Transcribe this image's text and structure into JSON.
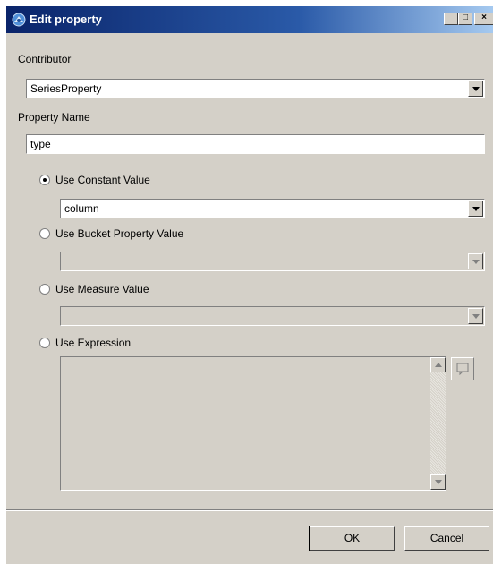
{
  "window": {
    "title": "Edit property",
    "icon": "app-icon",
    "controls": {
      "minimize": "_",
      "maximize": "□",
      "close": "×"
    }
  },
  "contributor": {
    "label": "Contributor",
    "selected": "SeriesProperty"
  },
  "property_name": {
    "label": "Property Name",
    "value": "type"
  },
  "options": {
    "constant": {
      "label": "Use Constant Value",
      "checked": true,
      "selected": "column"
    },
    "bucket": {
      "label": "Use Bucket Property Value",
      "checked": false,
      "selected": ""
    },
    "measure": {
      "label": "Use Measure Value",
      "checked": false,
      "selected": ""
    },
    "expression": {
      "label": "Use Expression",
      "checked": false,
      "value": ""
    }
  },
  "buttons": {
    "ok": "OK",
    "cancel": "Cancel"
  },
  "colors": {
    "face": "#d4d0c8",
    "title_start": "#0a246a",
    "title_end": "#a6caf0"
  }
}
